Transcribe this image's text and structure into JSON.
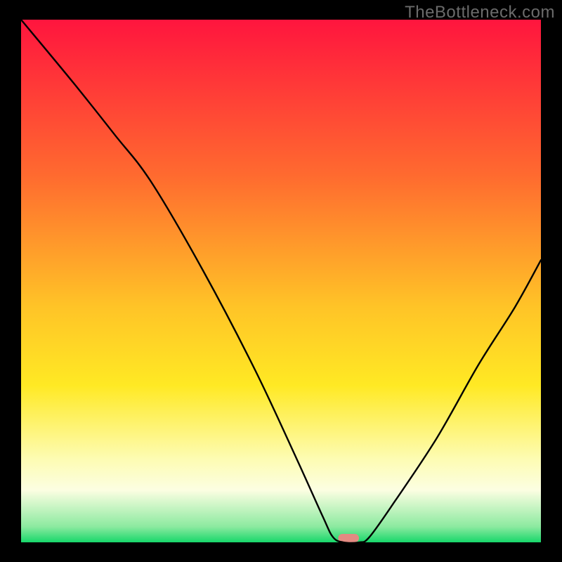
{
  "watermark": {
    "text": "TheBottleneck.com"
  },
  "chart_data": {
    "type": "line",
    "title": "",
    "xlabel": "",
    "ylabel": "",
    "xlim": [
      0,
      100
    ],
    "ylim": [
      0,
      100
    ],
    "background_gradient": {
      "stops": [
        {
          "offset": 0,
          "color": "#ff153e"
        },
        {
          "offset": 30,
          "color": "#ff6b2f"
        },
        {
          "offset": 55,
          "color": "#ffc427"
        },
        {
          "offset": 70,
          "color": "#ffe924"
        },
        {
          "offset": 84,
          "color": "#fdfcb2"
        },
        {
          "offset": 90,
          "color": "#fcfee2"
        },
        {
          "offset": 97,
          "color": "#8ceaa0"
        },
        {
          "offset": 100,
          "color": "#17d76a"
        }
      ]
    },
    "optimum_marker": {
      "x": 63,
      "y": 0,
      "width_pct": 4,
      "color": "#e38a82"
    },
    "series": [
      {
        "name": "bottleneck-curve",
        "points": [
          {
            "x": 0,
            "y": 100
          },
          {
            "x": 10,
            "y": 88
          },
          {
            "x": 18,
            "y": 78
          },
          {
            "x": 25,
            "y": 69
          },
          {
            "x": 35,
            "y": 52
          },
          {
            "x": 45,
            "y": 33
          },
          {
            "x": 53,
            "y": 16
          },
          {
            "x": 58,
            "y": 5
          },
          {
            "x": 60,
            "y": 1
          },
          {
            "x": 62,
            "y": 0
          },
          {
            "x": 65,
            "y": 0
          },
          {
            "x": 67,
            "y": 1
          },
          {
            "x": 72,
            "y": 8
          },
          {
            "x": 80,
            "y": 20
          },
          {
            "x": 88,
            "y": 34
          },
          {
            "x": 95,
            "y": 45
          },
          {
            "x": 100,
            "y": 54
          }
        ]
      }
    ]
  }
}
